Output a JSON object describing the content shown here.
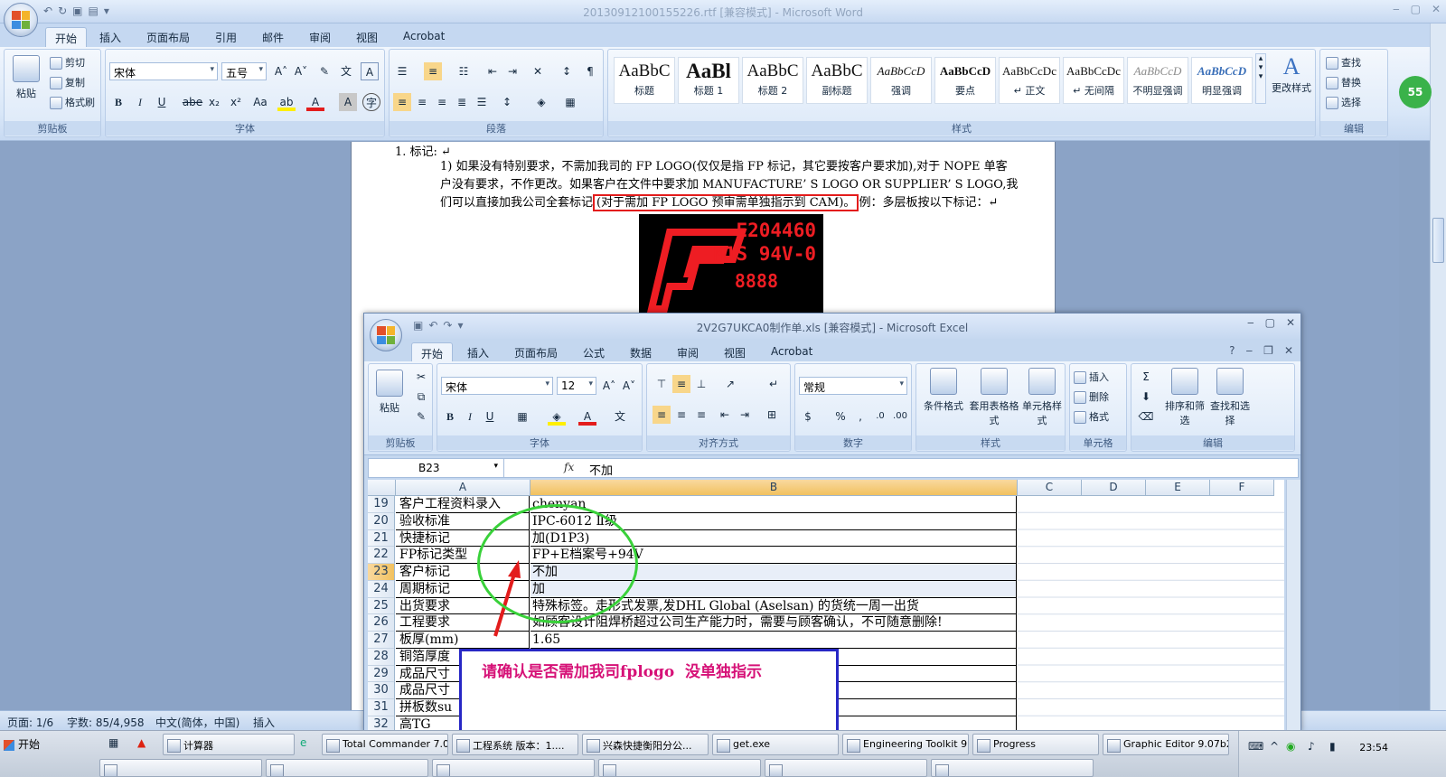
{
  "word": {
    "title": "20130912100155226.rtf [兼容模式] - Microsoft Word",
    "tabs": [
      "开始",
      "插入",
      "页面布局",
      "引用",
      "邮件",
      "审阅",
      "视图",
      "Acrobat"
    ],
    "clipboard": {
      "paste": "粘贴",
      "cut": "剪切",
      "copy": "复制",
      "format_painter": "格式刷",
      "label": "剪贴板"
    },
    "font": {
      "name": "宋体",
      "size": "五号",
      "label": "字体"
    },
    "paragraph": {
      "label": "段落"
    },
    "styles": {
      "label": "样式",
      "items": [
        {
          "preview": "AaBbC",
          "name": "标题"
        },
        {
          "preview": "AaBl",
          "name": "标题 1"
        },
        {
          "preview": "AaBbC",
          "name": "标题 2"
        },
        {
          "preview": "AaBbC",
          "name": "副标题"
        },
        {
          "preview": "AaBbCcD",
          "name": "强调"
        },
        {
          "preview": "AaBbCcD",
          "name": "要点"
        },
        {
          "preview": "AaBbCcDc",
          "name": "↵ 正文"
        },
        {
          "preview": "AaBbCcDc",
          "name": "↵ 无间隔"
        },
        {
          "preview": "AaBbCcD",
          "name": "不明显强调"
        },
        {
          "preview": "AaBbCcD",
          "name": "明显强调"
        }
      ],
      "change_styles": "更改样式"
    },
    "editing": {
      "find": "查找",
      "replace": "替换",
      "select": "选择",
      "label": "编辑"
    },
    "document": {
      "heading": "1. 标记: ↵",
      "para_prefix": "1)  如果没有特别要求，不需加我司的 FP LOGO(仅仅是指 FP 标记，其它要按客户要求加),对于 NOPE 单客户没有要求，不作更改。如果客户在文件中要求加 MANUFACTURE’ S LOGO OR SUPPLIER’ S LOGO,我们可以直接加我公司全套标记",
      "para_highlight": "(对于需加 FP LOGO 预审需单独指示到 CAM)。",
      "para_suffix": "例：多层板按以下标记：↵",
      "logo_lines": [
        "E204460",
        "M1S 94V-0",
        "8888"
      ]
    },
    "status": {
      "page": "页面: 1/6",
      "words": "字数: 85/4,958",
      "lang": "中文(简体，中国)",
      "mode": "插入"
    }
  },
  "excel": {
    "title": "2V2G7UKCA0制作单.xls [兼容模式] - Microsoft Excel",
    "tabs": [
      "开始",
      "插入",
      "页面布局",
      "公式",
      "数据",
      "审阅",
      "视图",
      "Acrobat"
    ],
    "clipboard": {
      "paste": "粘贴",
      "label": "剪贴板"
    },
    "font": {
      "name": "宋体",
      "size": "12",
      "label": "字体"
    },
    "alignment": {
      "label": "对齐方式"
    },
    "number": {
      "format": "常规",
      "label": "数字"
    },
    "styles": {
      "conditional": "条件格式",
      "table": "套用表格格式",
      "cell": "单元格样式",
      "label": "样式"
    },
    "cells": {
      "insert": "插入",
      "delete": "删除",
      "format": "格式",
      "label": "单元格"
    },
    "editing": {
      "sort": "排序和筛选",
      "find": "查找和选择",
      "label": "编辑"
    },
    "name_box": "B23",
    "formula": "不加",
    "columns": [
      "A",
      "B",
      "C",
      "D",
      "E",
      "F"
    ],
    "rows": [
      {
        "num": "19",
        "a": "客户工程资料录入",
        "b": "chenyan"
      },
      {
        "num": "20",
        "a": "验收标准",
        "b": "IPC-6012 Ⅱ级"
      },
      {
        "num": "21",
        "a": "快捷标记",
        "b": "加(D1P3)"
      },
      {
        "num": "22",
        "a": "FP标记类型",
        "b": "FP+E档案号+94V"
      },
      {
        "num": "23",
        "a": "客户标记",
        "b": "不加"
      },
      {
        "num": "24",
        "a": "周期标记",
        "b": "加"
      },
      {
        "num": "25",
        "a": "出货要求",
        "b": "特殊标签。走形式发票,发DHL Global (Aselsan) 的货统一周一出货"
      },
      {
        "num": "26",
        "a": "工程要求",
        "b": "如顾客设计阻焊桥超过公司生产能力时，需要与顾客确认，不可随意删除!"
      },
      {
        "num": "27",
        "a": "板厚(mm)",
        "b": "1.65"
      },
      {
        "num": "28",
        "a": "铜箔厚度",
        "b": ""
      },
      {
        "num": "29",
        "a": "成品尺寸",
        "b": ""
      },
      {
        "num": "30",
        "a": "成品尺寸",
        "b": ""
      },
      {
        "num": "31",
        "a": "拼板数su",
        "b": ""
      },
      {
        "num": "32",
        "a": "高TG",
        "b": ""
      }
    ]
  },
  "annotation": {
    "note": "请确认是否需加我司fplogo  没单独指示"
  },
  "taskbar": {
    "start": "开始",
    "tasks": [
      "计算器",
      "Total Commander 7.0...",
      "工程系统  版本：1....",
      "兴森快捷衡阳分公...",
      "get.exe",
      "Engineering Toolkit 9....",
      "Progress",
      "Graphic Editor 9.07b2..."
    ],
    "clock": "23:54",
    "badge": "55"
  },
  "colors": {
    "accent_red": "#e31c1c",
    "annotation_pink": "#d61177",
    "annotation_blue": "#2727c5",
    "ellipse_green": "#39d13a",
    "selected_header": "#f1c15f"
  }
}
